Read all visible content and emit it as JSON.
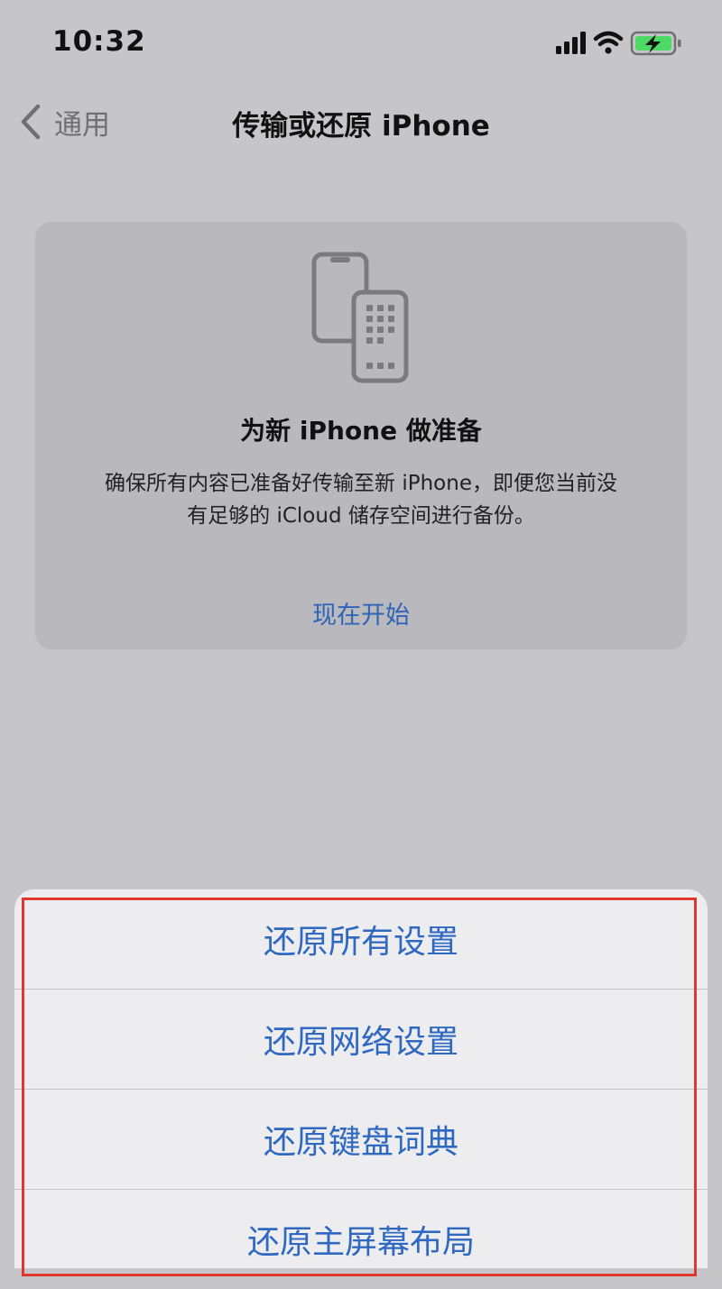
{
  "status_bar": {
    "time": "10:32",
    "icons": [
      "signal-icon",
      "wifi-icon",
      "battery-charging-icon"
    ]
  },
  "nav": {
    "back_label": "通用",
    "title": "传输或还原 iPhone"
  },
  "card": {
    "icon": "transfer-phones-icon",
    "title": "为新 iPhone 做准备",
    "description_line1": "确保所有内容已准备好传输至新 iPhone，即便您当前没",
    "description_line2": "有足够的 iCloud 储存空间进行备份。",
    "link_label": "现在开始"
  },
  "sheet": {
    "items": [
      {
        "label": "还原所有设置"
      },
      {
        "label": "还原网络设置"
      },
      {
        "label": "还原键盘词典"
      },
      {
        "label": "还原主屏幕布局"
      }
    ]
  },
  "colors": {
    "accent": "#2f68c0",
    "highlight_border": "#e0362c",
    "dimmed_background": "#c6c6c9",
    "battery_charging": "#4cd964"
  }
}
